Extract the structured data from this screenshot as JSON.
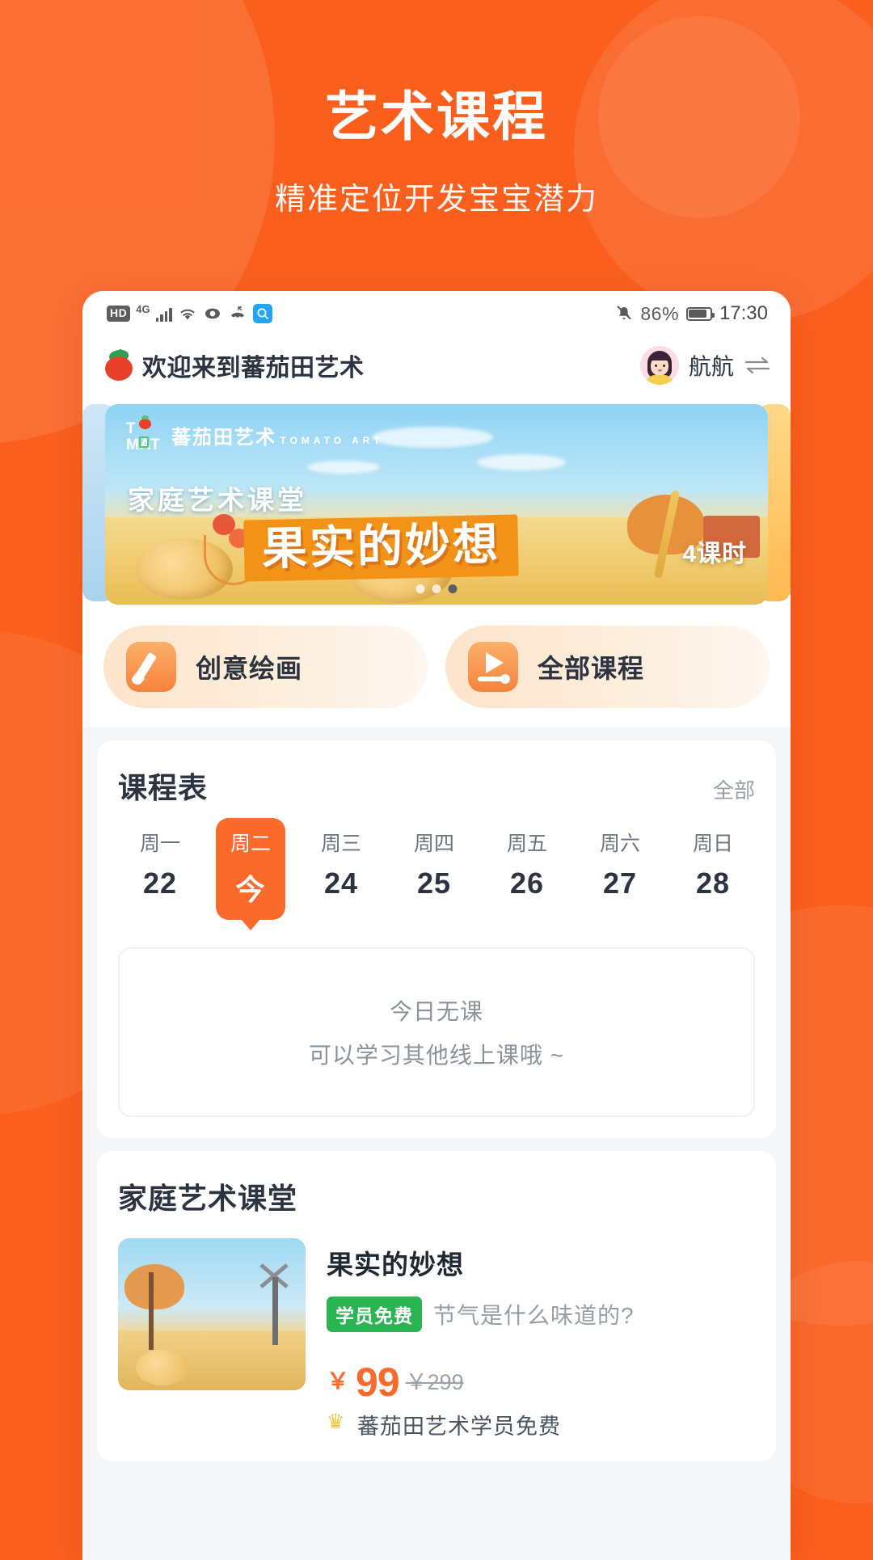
{
  "promo": {
    "title": "艺术课程",
    "subtitle": "精准定位开发宝宝潜力"
  },
  "statusbar": {
    "hd": "HD",
    "network": "4G",
    "battery_pct": "86%",
    "time": "17:30",
    "icons": [
      "hd-badge",
      "signal-bars",
      "wifi-icon",
      "eye-icon",
      "missed-call-icon",
      "search-icon",
      "mute-bell-icon",
      "battery-icon"
    ]
  },
  "header": {
    "greeting": "欢迎来到蕃茄田艺术",
    "username": "航航"
  },
  "banner": {
    "logo_cn": "蕃茄田艺术",
    "logo_en": "TOMATO ART",
    "logo_top": "T",
    "logo_bottom": "MAT",
    "subtitle": "家庭艺术课堂",
    "title": "果实的妙想",
    "lessons": "4课时",
    "dots_total": 3,
    "dot_active": 3
  },
  "quick_actions": [
    {
      "label": "创意绘画",
      "icon": "brush-icon"
    },
    {
      "label": "全部课程",
      "icon": "play-icon"
    }
  ],
  "schedule": {
    "title": "课程表",
    "more": "全部",
    "days": [
      {
        "weekday": "周一",
        "date": "22",
        "today": false
      },
      {
        "weekday": "周二",
        "date": "今",
        "today": true
      },
      {
        "weekday": "周三",
        "date": "24",
        "today": false
      },
      {
        "weekday": "周四",
        "date": "25",
        "today": false
      },
      {
        "weekday": "周五",
        "date": "26",
        "today": false
      },
      {
        "weekday": "周六",
        "date": "27",
        "today": false
      },
      {
        "weekday": "周日",
        "date": "28",
        "today": false
      }
    ],
    "empty_title": "今日无课",
    "empty_sub": "可以学习其他线上课哦 ~"
  },
  "family_class": {
    "title": "家庭艺术课堂",
    "course": {
      "name": "果实的妙想",
      "tag": "学员免费",
      "desc": "节气是什么味道的?",
      "currency": "￥",
      "price_now": "99",
      "price_old": "￥299",
      "vip_note": "蕃茄田艺术学员免费"
    }
  },
  "colors": {
    "brand_orange": "#FA5F1E",
    "accent_orange": "#F96A2B",
    "tag_green": "#2BB552",
    "text_dark": "#2b3440",
    "text_muted": "#9aa1a9"
  }
}
